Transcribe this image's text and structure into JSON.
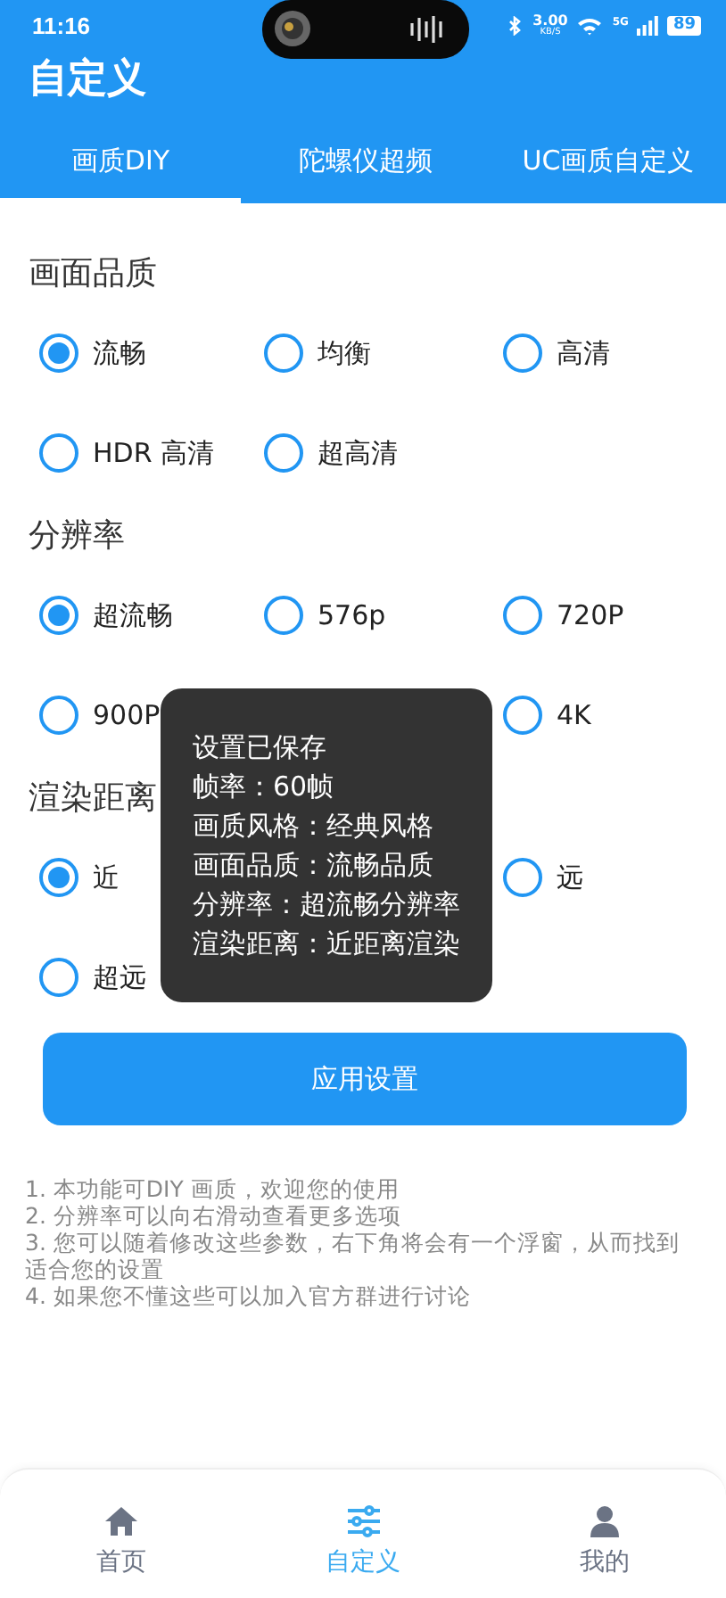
{
  "status_bar": {
    "time": "11:16",
    "speed": "3.00",
    "speed_unit": "KB/S",
    "network": "5G",
    "battery": "89"
  },
  "header": {
    "title": "自定义"
  },
  "tabs": [
    {
      "label": "画质DIY",
      "selected": true
    },
    {
      "label": "陀螺仪超频",
      "selected": false
    },
    {
      "label": "UC画质自定义",
      "selected": false
    }
  ],
  "sections": [
    {
      "title": "画面品质",
      "rows": [
        [
          {
            "label": "流畅",
            "selected": true
          },
          {
            "label": "均衡",
            "selected": false
          },
          {
            "label": "高清",
            "selected": false
          }
        ],
        [
          {
            "label": "HDR 高清",
            "selected": false
          },
          {
            "label": "超高清",
            "selected": false
          }
        ]
      ]
    },
    {
      "title": "分辨率",
      "rows": [
        [
          {
            "label": "超流畅",
            "selected": true
          },
          {
            "label": "576p",
            "selected": false
          },
          {
            "label": "720P",
            "selected": false
          }
        ],
        [
          {
            "label": "900P",
            "selected": false
          },
          null,
          {
            "label": "4K",
            "selected": false
          }
        ]
      ]
    },
    {
      "title": "渲染距离",
      "rows": [
        [
          {
            "label": "近",
            "selected": true
          },
          null,
          {
            "label": "远",
            "selected": false
          }
        ],
        [
          {
            "label": "超远",
            "selected": false
          }
        ]
      ]
    }
  ],
  "apply_button": "应用设置",
  "notes": [
    "1. 本功能可DIY 画质，欢迎您的使用",
    "2. 分辨率可以向右滑动查看更多选项",
    "3. 您可以随着修改这些参数，右下角将会有一个浮窗，从而找到适合您的设置",
    "4. 如果您不懂这些可以加入官方群进行讨论"
  ],
  "toast": [
    "设置已保存",
    "帧率：60帧",
    "画质风格：经典风格",
    "画面品质：流畅品质",
    "分辨率：超流畅分辨率",
    "渲染距离：近距离渲染"
  ],
  "bottom_nav": [
    {
      "label": "首页",
      "selected": false
    },
    {
      "label": "自定义",
      "selected": true
    },
    {
      "label": "我的",
      "selected": false
    }
  ]
}
